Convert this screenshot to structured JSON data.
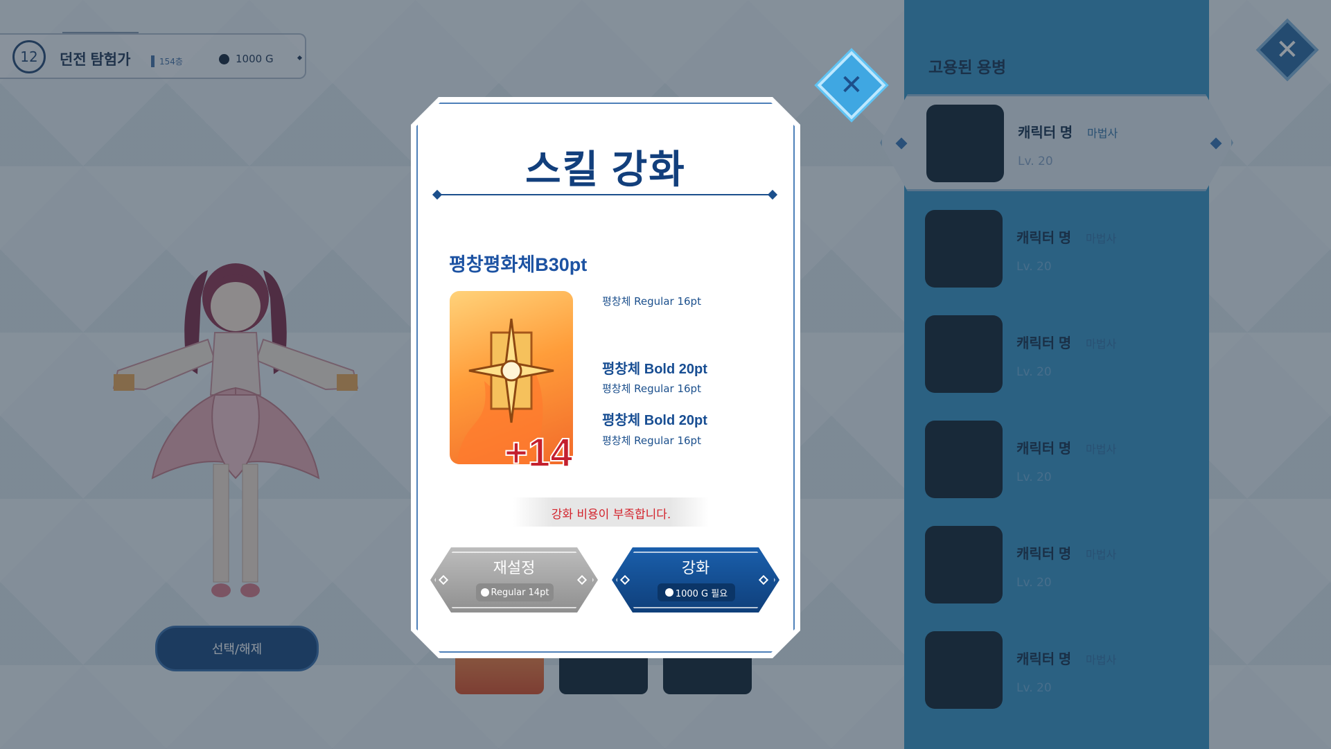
{
  "header": {
    "level": "12",
    "dungeon_name": "던전 탐험가",
    "floor": "154층",
    "gold": "1000 G"
  },
  "select_button_label": "선택/해제",
  "mercenary_panel": {
    "title": "고용된 용병",
    "items": [
      {
        "name": "캐릭터 명",
        "class": "마법사",
        "level": "Lv. 20",
        "selected": true
      },
      {
        "name": "캐릭터 명",
        "class": "마법사",
        "level": "Lv. 20",
        "selected": false
      },
      {
        "name": "캐릭터 명",
        "class": "마법사",
        "level": "Lv. 20",
        "selected": false
      },
      {
        "name": "캐릭터 명",
        "class": "마법사",
        "level": "Lv. 20",
        "selected": false
      },
      {
        "name": "캐릭터 명",
        "class": "마법사",
        "level": "Lv. 20",
        "selected": false
      },
      {
        "name": "캐릭터 명",
        "class": "마법사",
        "level": "Lv. 20",
        "selected": false
      }
    ]
  },
  "modal": {
    "title": "스킬 강화",
    "skill_name": "평창평화체B30pt",
    "skill_level": "+14",
    "descriptions": [
      "평창체 Regular 16pt",
      "평창체 Bold 20pt",
      "평창체 Regular 16pt",
      "평창체 Bold 20pt",
      "평창체 Regular 16pt"
    ],
    "warning": "강화 비용이 부족합니다.",
    "reset_button": {
      "label": "재설정",
      "sub": "Regular 14pt"
    },
    "enhance_button": {
      "label": "강화",
      "sub": "1000 G 필요"
    }
  },
  "colors": {
    "primary": "#123f7c",
    "panel": "#2f8ec2",
    "warning": "#d3222b",
    "skill_icon": "#ff9d3a"
  },
  "icons": {
    "close": "close-icon",
    "gold": "coin-icon"
  }
}
